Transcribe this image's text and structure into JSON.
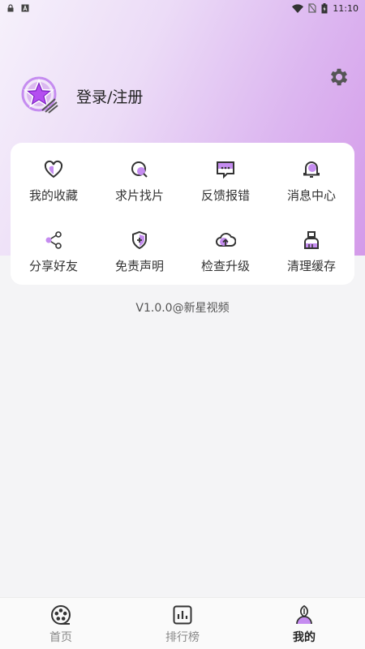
{
  "status_bar": {
    "time": "11:10"
  },
  "profile": {
    "login_label": "登录/注册"
  },
  "menu": {
    "items": [
      {
        "label": "我的收藏",
        "icon": "heart-icon"
      },
      {
        "label": "求片找片",
        "icon": "search-icon"
      },
      {
        "label": "反馈报错",
        "icon": "feedback-message-icon"
      },
      {
        "label": "消息中心",
        "icon": "bell-icon"
      },
      {
        "label": "分享好友",
        "icon": "share-icon"
      },
      {
        "label": "免责声明",
        "icon": "shield-icon"
      },
      {
        "label": "检查升级",
        "icon": "cloud-upload-icon"
      },
      {
        "label": "清理缓存",
        "icon": "broom-clean-icon"
      }
    ]
  },
  "version": "V1.0.0@新星视频",
  "tabs": [
    {
      "label": "首页",
      "icon": "film-reel-icon"
    },
    {
      "label": "排行榜",
      "icon": "chart-icon"
    },
    {
      "label": "我的",
      "icon": "profile-icon",
      "active": true
    }
  ],
  "colors": {
    "accent": "#c58cf0",
    "accent_dark": "#a23fd9"
  }
}
